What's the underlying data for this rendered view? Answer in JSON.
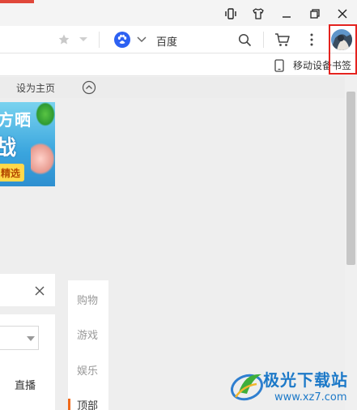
{
  "address_bar": {
    "search_engine_label": "百度"
  },
  "bookmark_bar": {
    "mobile_bookmarks_label": "移动设备书签"
  },
  "page": {
    "set_home_label": "设为主页",
    "banner": {
      "line1": "方晒",
      "line2": "战",
      "button_label": "精选"
    },
    "live_tab_label": "直播",
    "side_nav": {
      "items": [
        {
          "label": "购物"
        },
        {
          "label": "游戏"
        },
        {
          "label": "娱乐"
        },
        {
          "label": "顶部"
        }
      ]
    }
  },
  "watermark": {
    "main": "极光下载站",
    "sub": "www.xz7.com"
  },
  "colors": {
    "highlight": "#e4231f",
    "accent_orange": "#f06a1c",
    "baidu_blue": "#2d61f2",
    "watermark_blue": "#1d79c8"
  },
  "icons": [
    "vibrate-icon",
    "shirt-icon",
    "minimize-icon",
    "restore-icon",
    "close-icon",
    "star-icon",
    "chevron-down-icon",
    "baidu-paw-icon",
    "search-icon",
    "cart-icon",
    "more-vertical-icon",
    "avatar",
    "mobile-device-icon",
    "collapse-up-icon",
    "close-x-icon"
  ]
}
